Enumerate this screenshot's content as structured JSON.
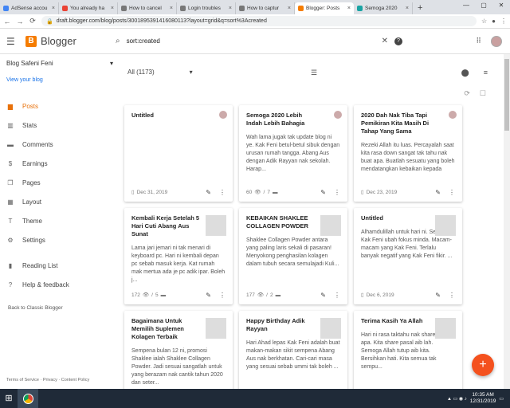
{
  "tabs": [
    {
      "label": "AdSense accou",
      "fav": "#4285f4"
    },
    {
      "label": "You already ha",
      "fav": "#ea4335"
    },
    {
      "label": "How to cancel",
      "fav": "#777"
    },
    {
      "label": "Login troubles",
      "fav": "#777"
    },
    {
      "label": "How to captur",
      "fav": "#777"
    },
    {
      "label": "Blogger: Posts",
      "fav": "#f57c00"
    },
    {
      "label": "Semoga 2020",
      "fav": "#1aa3a3"
    }
  ],
  "url": "draft.blogger.com/blog/posts/3001895391416080113?layout=grid&q=sort%3Acreated",
  "app": {
    "name": "Blogger",
    "search_query": "sort:created"
  },
  "sidebar": {
    "blog_name": "Blog Safeni Feni",
    "view_blog": "View your blog",
    "items": [
      {
        "label": "Posts",
        "icon": "▆"
      },
      {
        "label": "Stats",
        "icon": "▥"
      },
      {
        "label": "Comments",
        "icon": "▬"
      },
      {
        "label": "Earnings",
        "icon": "$"
      },
      {
        "label": "Pages",
        "icon": "❐"
      },
      {
        "label": "Layout",
        "icon": "▦"
      },
      {
        "label": "Theme",
        "icon": "T"
      },
      {
        "label": "Settings",
        "icon": "⚙"
      }
    ],
    "items2": [
      {
        "label": "Reading List",
        "icon": "▮"
      },
      {
        "label": "Help & feedback",
        "icon": "?"
      }
    ],
    "classic": "Back to Classic Blogger",
    "footer": "Terms of Service · Privacy · Content Policy"
  },
  "filter": {
    "label": "All (1173)"
  },
  "posts": [
    {
      "title": "Untitled",
      "body": "",
      "meta_date": "Dec 31, 2019",
      "thumb": "avatar"
    },
    {
      "title": "Semoga 2020 Lebih Indah Lebih Bahagia",
      "body": "Wah lama jugak tak update blog ni ye. Kak Feni betul-betul sibuk dengan urusan rumah tangga. Abang Aus dengan Adik Rayyan nak sekolah. Harap...",
      "views": "60",
      "comments": "7",
      "thumb": "avatar"
    },
    {
      "title": "2020 Dah Nak Tiba Tapi Pemikiran Kita Masih Di Tahap Yang Sama",
      "body": "Rezeki Allah itu luas. Percayalah saat kita rasa down sangat tak tahu nak buat apa. Buatlah sesuatu yang boleh mendatangkan kebaikan kepada",
      "meta_date": "Dec 23, 2019",
      "thumb": "avatar"
    },
    {
      "title": "Kembali Kerja Setelah 5 Hari Cuti Abang Aus Sunat",
      "body": "Lama jari jemari ni tak menari di keyboard pc. Hari ni kembali depan pc sebab masuk kerja. Kat rumah mak mertua ada je pc adik ipar. Boleh j...",
      "views": "172",
      "comments": "5",
      "thumb": "photo"
    },
    {
      "title": "KEBAIKAN SHAKLEE COLLAGEN POWDER",
      "body": "Shaklee Collagen Powder antara yang paling laris sekali di pasaran! Menyokong penghasilan kolagen dalam tubuh secara semulajadi Kuli...",
      "views": "177",
      "comments": "2",
      "thumb": "photo"
    },
    {
      "title": "Untitled",
      "body": "Alhamdulillah untuk hari ni. Semalam Kak Feni ubah fokus minda. Macam-macam yang Kak Feni. Terlalu banyak negatif yang Kak Feni fikir. ...",
      "meta_date": "Dec 6, 2019",
      "thumb": "photo"
    },
    {
      "title": "Bagaimana Untuk Memilih Suplemen Kolagen Terbaik",
      "body": "Sempena bulan 12 ni, promosi Shaklee ialah Shaklee Collagen Powder. Jadi sesuai sangatlah untuk yang berazam nak cantik tahun 2020 dan seter...",
      "thumb": "photo"
    },
    {
      "title": "Happy Birthday Adik Rayyan",
      "body": "Hari Ahad lepas Kak Feni adalah buat makan-makan sikit sempena Abang Aus nak berkhatan. Cari-cari masa yang sesuai sebab ummi tak boleh ...",
      "thumb": "photo"
    },
    {
      "title": "Terima Kasih Ya Allah",
      "body": "Hari ni rasa taktahu nak share pasal apa. Kita share pasal aib lah. Semoga Allah tutup aib kita. Bersihkan hati. Kita semua tak sempu...",
      "thumb": "photo"
    }
  ],
  "clock": {
    "time": "10:35 AM",
    "date": "12/31/2019"
  }
}
